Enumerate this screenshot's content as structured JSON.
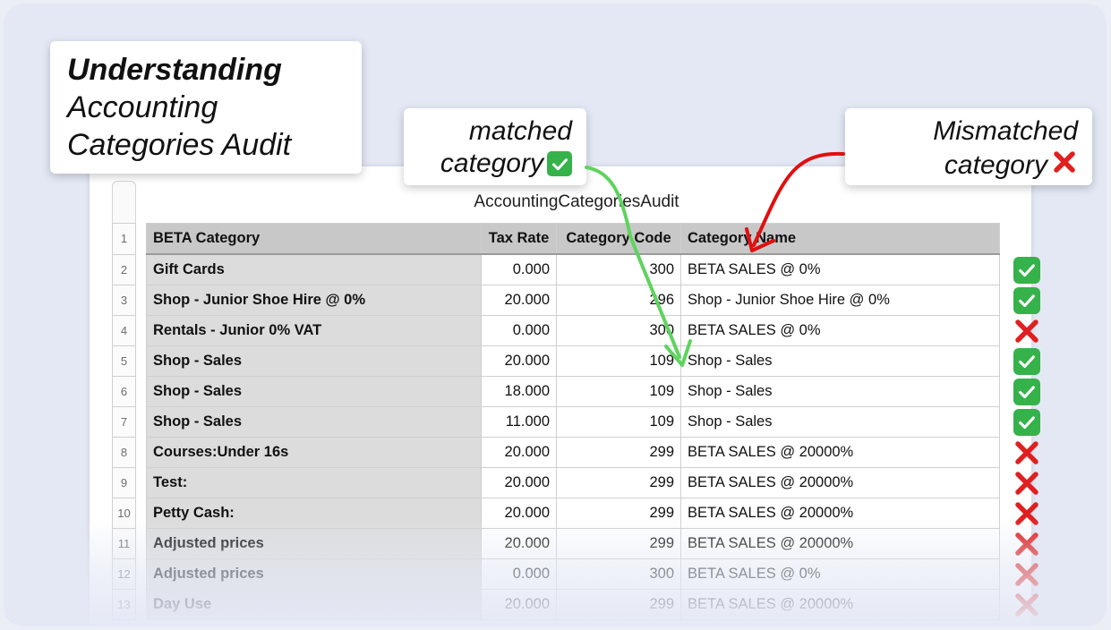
{
  "title": {
    "line1": "Understanding",
    "line2": "Accounting",
    "line3": "Categories Audit"
  },
  "callouts": {
    "matched": {
      "line1": "matched",
      "line2": "category",
      "icon": "check-icon"
    },
    "mismatched": {
      "line1": "Mismatched",
      "line2": "category",
      "icon": "cross-icon"
    }
  },
  "sheet": {
    "title": "AccountingCategoriesAudit",
    "headers": [
      "BETA Category",
      "Tax Rate",
      "Category Code",
      "Category Name"
    ],
    "row_numbers": [
      "1",
      "2",
      "3",
      "4",
      "5",
      "6",
      "7",
      "8",
      "9",
      "10",
      "11",
      "12",
      "13"
    ],
    "rows": [
      {
        "category": "Gift Cards",
        "tax": "0.000",
        "code": "300",
        "name": "BETA SALES @ 0%",
        "status": "match"
      },
      {
        "category": "Shop - Junior Shoe Hire @ 0%",
        "tax": "20.000",
        "code": "296",
        "name": "Shop - Junior Shoe Hire @ 0%",
        "status": "match"
      },
      {
        "category": "Rentals - Junior 0% VAT",
        "tax": "0.000",
        "code": "300",
        "name": "BETA SALES @ 0%",
        "status": "mismatch"
      },
      {
        "category": "Shop - Sales",
        "tax": "20.000",
        "code": "109",
        "name": "Shop - Sales",
        "status": "match"
      },
      {
        "category": "Shop - Sales",
        "tax": "18.000",
        "code": "109",
        "name": "Shop - Sales",
        "status": "match"
      },
      {
        "category": "Shop - Sales",
        "tax": "11.000",
        "code": "109",
        "name": "Shop - Sales",
        "status": "match"
      },
      {
        "category": "Courses:Under 16s",
        "tax": "20.000",
        "code": "299",
        "name": "BETA SALES @ 20000%",
        "status": "mismatch"
      },
      {
        "category": "Test:",
        "tax": "20.000",
        "code": "299",
        "name": "BETA SALES @ 20000%",
        "status": "mismatch"
      },
      {
        "category": "Petty Cash:",
        "tax": "20.000",
        "code": "299",
        "name": "BETA SALES @ 20000%",
        "status": "mismatch"
      },
      {
        "category": "Adjusted prices",
        "tax": "20.000",
        "code": "299",
        "name": "BETA SALES @ 20000%",
        "status": "mismatch"
      },
      {
        "category": "Adjusted prices",
        "tax": "0.000",
        "code": "300",
        "name": "BETA SALES @ 0%",
        "status": "mismatch"
      },
      {
        "category": "Day Use",
        "tax": "20.000",
        "code": "299",
        "name": "BETA SALES @ 20000%",
        "status": "mismatch"
      }
    ]
  },
  "colors": {
    "match": "#36b24a",
    "mismatch": "#e02020",
    "matched_arrow": "#5fd35f",
    "mismatched_arrow": "#e01010"
  }
}
